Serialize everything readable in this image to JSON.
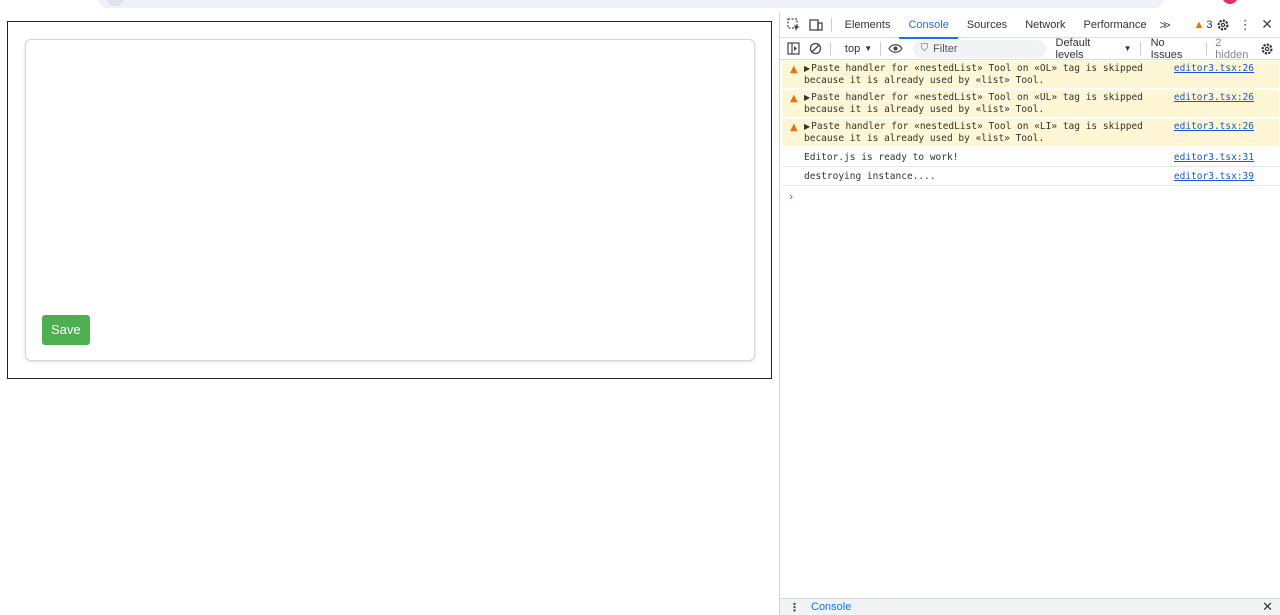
{
  "page": {
    "save_label": "Save"
  },
  "devtools": {
    "tabs": [
      "Elements",
      "Console",
      "Sources",
      "Network",
      "Performance"
    ],
    "active_tab": "Console",
    "more_tabs_icon": ">>",
    "warning_count": "3",
    "context": "top",
    "filter_placeholder": "Filter",
    "levels": "Default levels",
    "issues": "No Issues",
    "hidden": "2 hidden",
    "drawer_label": "Console",
    "colors": {
      "accent": "#1a73e8",
      "warning_bg": "#fef6d5",
      "warning_icon": "#e8710a",
      "save_green": "#4caf50"
    }
  },
  "console": {
    "messages": [
      {
        "level": "warning",
        "text": "Paste handler for «nestedList» Tool on «OL» tag is skipped\nbecause it is already used by «list» Tool.",
        "source": "editor3.tsx:26"
      },
      {
        "level": "warning",
        "text": "Paste handler for «nestedList» Tool on «UL» tag is skipped\nbecause it is already used by «list» Tool.",
        "source": "editor3.tsx:26"
      },
      {
        "level": "warning",
        "text": "Paste handler for «nestedList» Tool on «LI» tag is skipped\nbecause it is already used by «list» Tool.",
        "source": "editor3.tsx:26"
      },
      {
        "level": "info",
        "text": "Editor.js is ready to work!",
        "source": "editor3.tsx:31"
      },
      {
        "level": "info",
        "text": "destroying instance....",
        "source": "editor3.tsx:39"
      }
    ]
  }
}
